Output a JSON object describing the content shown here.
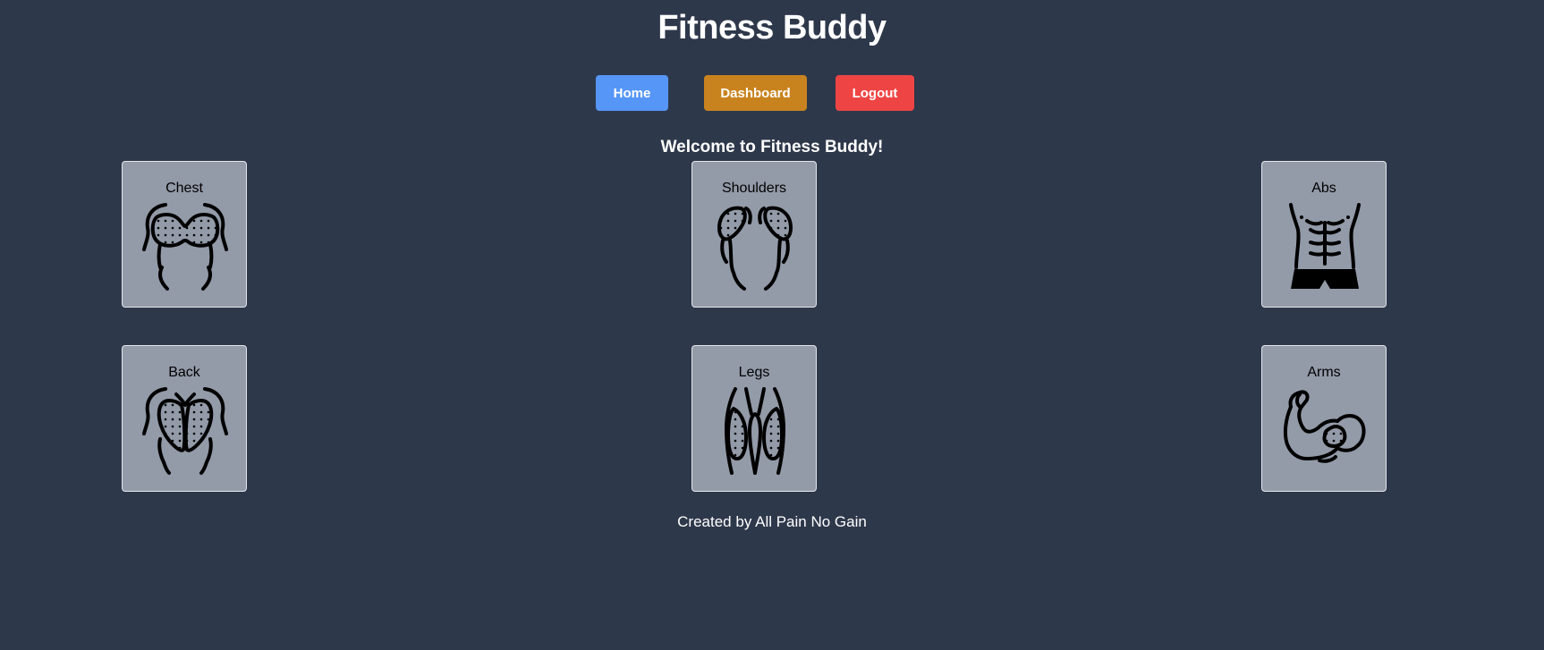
{
  "header": {
    "title": "Fitness Buddy"
  },
  "nav": {
    "home": "Home",
    "dashboard": "Dashboard",
    "logout": "Logout"
  },
  "main": {
    "welcome": "Welcome to Fitness Buddy!",
    "muscle_groups": [
      {
        "label": "Chest",
        "icon": "chest-icon"
      },
      {
        "label": "Shoulders",
        "icon": "shoulders-icon"
      },
      {
        "label": "Abs",
        "icon": "abs-icon"
      },
      {
        "label": "Back",
        "icon": "back-icon"
      },
      {
        "label": "Legs",
        "icon": "legs-icon"
      },
      {
        "label": "Arms",
        "icon": "arms-icon"
      }
    ]
  },
  "footer": {
    "text": "Created by All Pain No Gain"
  },
  "colors": {
    "background": "#2e384b",
    "home_button": "#5596f7",
    "dashboard_button": "#c9831e",
    "logout_button": "#ef4444",
    "card": "#939aa8"
  }
}
